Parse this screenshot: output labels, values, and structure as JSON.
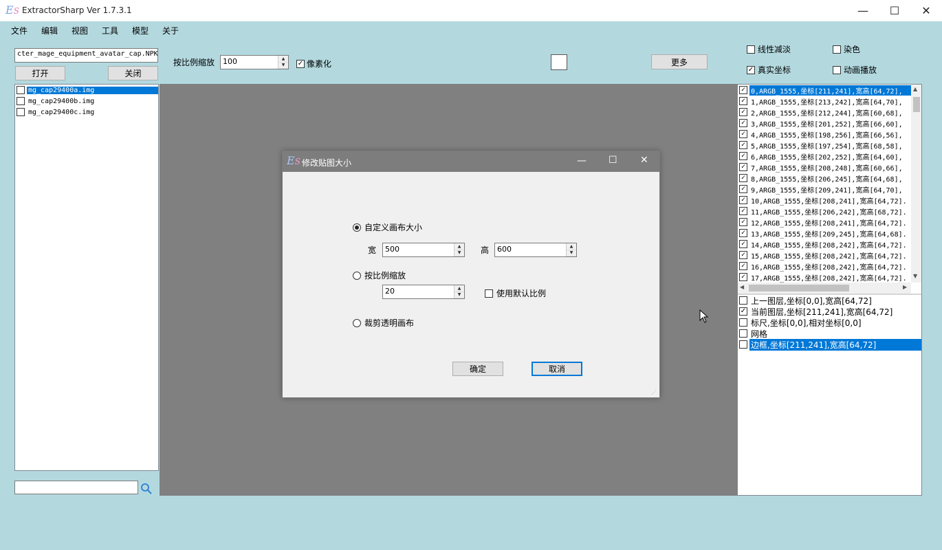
{
  "app": {
    "logo_e": "E",
    "logo_s": "S",
    "title": "ExtractorSharp Ver 1.7.3.1",
    "minimize": "—",
    "maximize": "☐",
    "close": "✕"
  },
  "menu": [
    "文件",
    "编辑",
    "视图",
    "工具",
    "模型",
    "关于"
  ],
  "left": {
    "file_path": "cter_mage_equipment_avatar_cap.NPK",
    "open_label": "打开",
    "close_label": "关闭",
    "files": [
      {
        "name": "mg_cap29400a.img",
        "checked": false,
        "selected": true
      },
      {
        "name": "mg_cap29400b.img",
        "checked": false,
        "selected": false
      },
      {
        "name": "mg_cap29400c.img",
        "checked": false,
        "selected": false
      }
    ],
    "search_value": ""
  },
  "toolbar": {
    "scale_label": "按比例缩放",
    "scale_value": "100",
    "pixelate_label": "像素化",
    "pixelate_checked": true,
    "more_label": "更多"
  },
  "options": {
    "linear_fade": {
      "label": "线性减淡",
      "checked": false
    },
    "dye": {
      "label": "染色",
      "checked": false
    },
    "real_coords": {
      "label": "真实坐标",
      "checked": true
    },
    "animation": {
      "label": "动画播放",
      "checked": false
    }
  },
  "frames": [
    "0,ARGB_1555,坐标[211,241],宽高[64,72],",
    "1,ARGB_1555,坐标[213,242],宽高[64,70],",
    "2,ARGB_1555,坐标[212,244],宽高[60,68],",
    "3,ARGB_1555,坐标[201,252],宽高[66,60],",
    "4,ARGB_1555,坐标[198,256],宽高[66,56],",
    "5,ARGB_1555,坐标[197,254],宽高[68,58],",
    "6,ARGB_1555,坐标[202,252],宽高[64,60],",
    "7,ARGB_1555,坐标[208,248],宽高[60,66],",
    "8,ARGB_1555,坐标[206,245],宽高[64,68],",
    "9,ARGB_1555,坐标[209,241],宽高[64,70],",
    "10,ARGB_1555,坐标[208,241],宽高[64,72].",
    "11,ARGB_1555,坐标[206,242],宽高[68,72].",
    "12,ARGB_1555,坐标[208,241],宽高[64,72].",
    "13,ARGB_1555,坐标[209,245],宽高[64,68].",
    "14,ARGB_1555,坐标[208,242],宽高[64,72].",
    "15,ARGB_1555,坐标[208,242],宽高[64,72].",
    "16,ARGB_1555,坐标[208,242],宽高[64,72].",
    "17,ARGB_1555,坐标[208,242],宽高[64,72]."
  ],
  "layers": [
    {
      "label": "上一图层,坐标[0,0],宽高[64,72]",
      "checked": false,
      "selected": false
    },
    {
      "label": "当前图层,坐标[211,241],宽高[64,72]",
      "checked": true,
      "selected": false
    },
    {
      "label": "标尺,坐标[0,0],相对坐标[0,0]",
      "checked": false,
      "selected": false
    },
    {
      "label": "网格",
      "checked": false,
      "selected": false
    },
    {
      "label": "边框,坐标[211,241],宽高[64,72]",
      "checked": false,
      "selected": true
    }
  ],
  "dialog": {
    "logo_e": "E",
    "logo_s": "S",
    "title": "修改贴图大小",
    "minimize": "—",
    "maximize": "☐",
    "close": "✕",
    "custom_canvas_label": "自定义画布大小",
    "custom_selected": true,
    "width_label": "宽",
    "width_value": "500",
    "height_label": "高",
    "height_value": "600",
    "scale_label": "按比例缩放",
    "scale_value": "20",
    "default_ratio_label": "使用默认比例",
    "default_ratio_checked": false,
    "crop_label": "裁剪透明画布",
    "ok_label": "确定",
    "cancel_label": "取消"
  }
}
